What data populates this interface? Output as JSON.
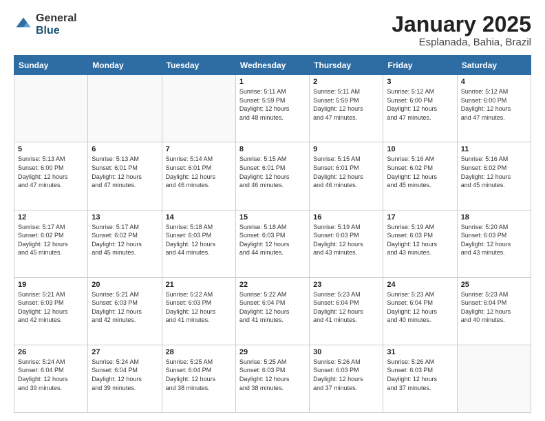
{
  "logo": {
    "general": "General",
    "blue": "Blue"
  },
  "header": {
    "title": "January 2025",
    "subtitle": "Esplanada, Bahia, Brazil"
  },
  "weekdays": [
    "Sunday",
    "Monday",
    "Tuesday",
    "Wednesday",
    "Thursday",
    "Friday",
    "Saturday"
  ],
  "days": [
    {
      "num": "",
      "info": ""
    },
    {
      "num": "",
      "info": ""
    },
    {
      "num": "",
      "info": ""
    },
    {
      "num": "1",
      "info": "Sunrise: 5:11 AM\nSunset: 5:59 PM\nDaylight: 12 hours\nand 48 minutes."
    },
    {
      "num": "2",
      "info": "Sunrise: 5:11 AM\nSunset: 5:59 PM\nDaylight: 12 hours\nand 47 minutes."
    },
    {
      "num": "3",
      "info": "Sunrise: 5:12 AM\nSunset: 6:00 PM\nDaylight: 12 hours\nand 47 minutes."
    },
    {
      "num": "4",
      "info": "Sunrise: 5:12 AM\nSunset: 6:00 PM\nDaylight: 12 hours\nand 47 minutes."
    },
    {
      "num": "5",
      "info": "Sunrise: 5:13 AM\nSunset: 6:00 PM\nDaylight: 12 hours\nand 47 minutes."
    },
    {
      "num": "6",
      "info": "Sunrise: 5:13 AM\nSunset: 6:01 PM\nDaylight: 12 hours\nand 47 minutes."
    },
    {
      "num": "7",
      "info": "Sunrise: 5:14 AM\nSunset: 6:01 PM\nDaylight: 12 hours\nand 46 minutes."
    },
    {
      "num": "8",
      "info": "Sunrise: 5:15 AM\nSunset: 6:01 PM\nDaylight: 12 hours\nand 46 minutes."
    },
    {
      "num": "9",
      "info": "Sunrise: 5:15 AM\nSunset: 6:01 PM\nDaylight: 12 hours\nand 46 minutes."
    },
    {
      "num": "10",
      "info": "Sunrise: 5:16 AM\nSunset: 6:02 PM\nDaylight: 12 hours\nand 45 minutes."
    },
    {
      "num": "11",
      "info": "Sunrise: 5:16 AM\nSunset: 6:02 PM\nDaylight: 12 hours\nand 45 minutes."
    },
    {
      "num": "12",
      "info": "Sunrise: 5:17 AM\nSunset: 6:02 PM\nDaylight: 12 hours\nand 45 minutes."
    },
    {
      "num": "13",
      "info": "Sunrise: 5:17 AM\nSunset: 6:02 PM\nDaylight: 12 hours\nand 45 minutes."
    },
    {
      "num": "14",
      "info": "Sunrise: 5:18 AM\nSunset: 6:03 PM\nDaylight: 12 hours\nand 44 minutes."
    },
    {
      "num": "15",
      "info": "Sunrise: 5:18 AM\nSunset: 6:03 PM\nDaylight: 12 hours\nand 44 minutes."
    },
    {
      "num": "16",
      "info": "Sunrise: 5:19 AM\nSunset: 6:03 PM\nDaylight: 12 hours\nand 43 minutes."
    },
    {
      "num": "17",
      "info": "Sunrise: 5:19 AM\nSunset: 6:03 PM\nDaylight: 12 hours\nand 43 minutes."
    },
    {
      "num": "18",
      "info": "Sunrise: 5:20 AM\nSunset: 6:03 PM\nDaylight: 12 hours\nand 43 minutes."
    },
    {
      "num": "19",
      "info": "Sunrise: 5:21 AM\nSunset: 6:03 PM\nDaylight: 12 hours\nand 42 minutes."
    },
    {
      "num": "20",
      "info": "Sunrise: 5:21 AM\nSunset: 6:03 PM\nDaylight: 12 hours\nand 42 minutes."
    },
    {
      "num": "21",
      "info": "Sunrise: 5:22 AM\nSunset: 6:03 PM\nDaylight: 12 hours\nand 41 minutes."
    },
    {
      "num": "22",
      "info": "Sunrise: 5:22 AM\nSunset: 6:04 PM\nDaylight: 12 hours\nand 41 minutes."
    },
    {
      "num": "23",
      "info": "Sunrise: 5:23 AM\nSunset: 6:04 PM\nDaylight: 12 hours\nand 41 minutes."
    },
    {
      "num": "24",
      "info": "Sunrise: 5:23 AM\nSunset: 6:04 PM\nDaylight: 12 hours\nand 40 minutes."
    },
    {
      "num": "25",
      "info": "Sunrise: 5:23 AM\nSunset: 6:04 PM\nDaylight: 12 hours\nand 40 minutes."
    },
    {
      "num": "26",
      "info": "Sunrise: 5:24 AM\nSunset: 6:04 PM\nDaylight: 12 hours\nand 39 minutes."
    },
    {
      "num": "27",
      "info": "Sunrise: 5:24 AM\nSunset: 6:04 PM\nDaylight: 12 hours\nand 39 minutes."
    },
    {
      "num": "28",
      "info": "Sunrise: 5:25 AM\nSunset: 6:04 PM\nDaylight: 12 hours\nand 38 minutes."
    },
    {
      "num": "29",
      "info": "Sunrise: 5:25 AM\nSunset: 6:03 PM\nDaylight: 12 hours\nand 38 minutes."
    },
    {
      "num": "30",
      "info": "Sunrise: 5:26 AM\nSunset: 6:03 PM\nDaylight: 12 hours\nand 37 minutes."
    },
    {
      "num": "31",
      "info": "Sunrise: 5:26 AM\nSunset: 6:03 PM\nDaylight: 12 hours\nand 37 minutes."
    },
    {
      "num": "",
      "info": ""
    }
  ]
}
